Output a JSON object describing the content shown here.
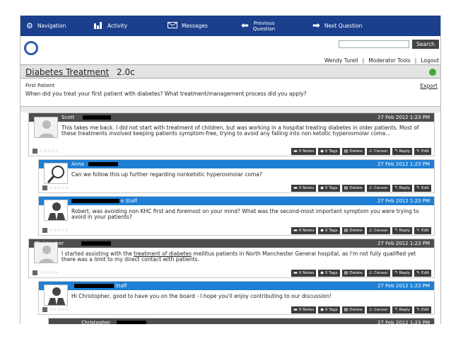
{
  "nav": {
    "navigation": "Navigation",
    "activity": "Activity",
    "messages": "Messages",
    "previous_l1": "Previous",
    "previous_l2": "Question",
    "next": "Next Question"
  },
  "icons": {
    "navigation": "gear-icon",
    "activity": "bar-chart-icon",
    "messages": "envelope-icon",
    "previous": "arrow-left-icon",
    "next": "arrow-right-icon"
  },
  "header": {
    "search_label": "Search",
    "user": "Wendy Turell",
    "moderator": "Moderator Tools",
    "logout": "Logout"
  },
  "title": {
    "name": "Diabetes Treatment",
    "version": "2.0c"
  },
  "question": {
    "label": "First Patient",
    "text": "When did you treat your first patient with diabetes? What treatment/management process did you apply?",
    "export": "Export"
  },
  "actions": {
    "notes": "0 Notes",
    "tags": "0 Tags",
    "delete": "Delete",
    "censor": "Censor",
    "reply": "Reply",
    "edit": "Edit"
  },
  "stars": "☆☆☆☆☆",
  "posts": [
    {
      "name": "Scott",
      "time": "27 Feb 2012 1:23 PM",
      "body": "This takes me back. I did not start with treatment of children, but was working in a hospital treating diabetes in older patients. Most of these treatments involved keeping patients symptom-free, trying to avoid any falling into non ketotic hyperosmolar coma..."
    },
    {
      "name": "Anna",
      "time": "27 Feb 2012 1:23 PM",
      "body": "Can we follow this up further regarding nonketotic hyperosmolar coma?"
    },
    {
      "name": "Staff",
      "name_prefix": "e",
      "time": "27 Feb 2012 1:23 PM",
      "body": "Robert, was avoiding non KHC first and foremost on your mind? What was the second-most important symptom you were trying to avoid in your patients?"
    },
    {
      "name": "Christopher",
      "time": "27 Feb 2012 1:23 PM",
      "body_pre": "I started assisting with the ",
      "body_link": "treatment of diabetes",
      "body_post": " mellitus patients in North Manchester General hospital, as I'm not fully qualified yet there was a limit to my direct contact with patients."
    },
    {
      "name": "Staff",
      "time": "27 Feb 2012 1:23 PM",
      "body": "Hi Christopher, good to have you on the board - I hope you'll enjoy contributing to our discussion!"
    },
    {
      "name": "Christopher",
      "time": "27 Feb 2012 1:23 PM"
    }
  ],
  "colors": {
    "nav_bg": "#1b3f8c",
    "dark_header": "#4e4e4e",
    "blue_header": "#1e7fd4",
    "status_green": "#3daa38"
  }
}
